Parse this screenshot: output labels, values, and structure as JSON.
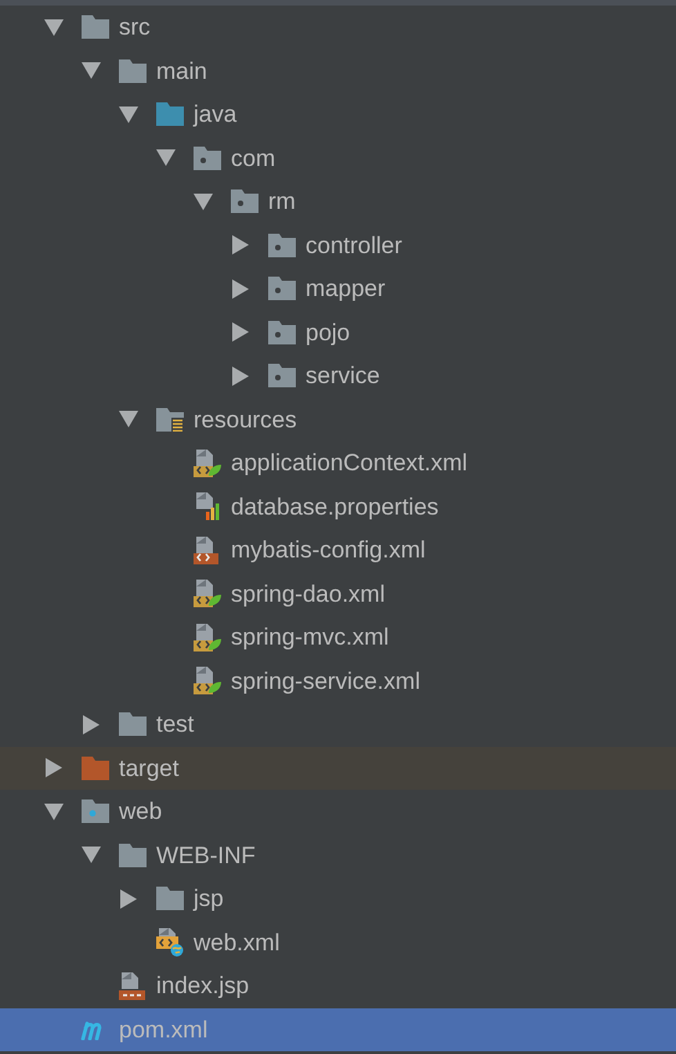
{
  "tree": [
    {
      "name": "src",
      "kind": "folder",
      "expanded": true,
      "selected": false,
      "children": [
        {
          "name": "main",
          "kind": "folder",
          "expanded": true,
          "selected": false,
          "children": [
            {
              "name": "java",
              "kind": "source-folder",
              "expanded": true,
              "selected": false,
              "children": [
                {
                  "name": "com",
                  "kind": "package",
                  "expanded": true,
                  "selected": false,
                  "children": [
                    {
                      "name": "rm",
                      "kind": "package",
                      "expanded": true,
                      "selected": false,
                      "children": [
                        {
                          "name": "controller",
                          "kind": "package",
                          "expanded": false,
                          "selected": false
                        },
                        {
                          "name": "mapper",
                          "kind": "package",
                          "expanded": false,
                          "selected": false
                        },
                        {
                          "name": "pojo",
                          "kind": "package",
                          "expanded": false,
                          "selected": false
                        },
                        {
                          "name": "service",
                          "kind": "package",
                          "expanded": false,
                          "selected": false
                        }
                      ]
                    }
                  ]
                }
              ]
            },
            {
              "name": "resources",
              "kind": "resources-folder",
              "expanded": true,
              "selected": false,
              "children": [
                {
                  "name": "applicationContext.xml",
                  "kind": "spring-xml",
                  "selected": false
                },
                {
                  "name": "database.properties",
                  "kind": "properties",
                  "selected": false
                },
                {
                  "name": "mybatis-config.xml",
                  "kind": "xml",
                  "selected": false
                },
                {
                  "name": "spring-dao.xml",
                  "kind": "spring-xml",
                  "selected": false
                },
                {
                  "name": "spring-mvc.xml",
                  "kind": "spring-xml",
                  "selected": false
                },
                {
                  "name": "spring-service.xml",
                  "kind": "spring-xml",
                  "selected": false
                }
              ]
            }
          ]
        },
        {
          "name": "test",
          "kind": "folder",
          "expanded": false,
          "selected": false
        }
      ]
    },
    {
      "name": "target",
      "kind": "excluded-folder",
      "expanded": false,
      "selected": false
    },
    {
      "name": "web",
      "kind": "web-folder",
      "expanded": true,
      "selected": false,
      "children": [
        {
          "name": "WEB-INF",
          "kind": "folder",
          "expanded": true,
          "selected": false,
          "children": [
            {
              "name": "jsp",
              "kind": "folder",
              "expanded": false,
              "selected": false
            },
            {
              "name": "web.xml",
              "kind": "web-xml",
              "selected": false
            }
          ]
        },
        {
          "name": "index.jsp",
          "kind": "jsp",
          "selected": false
        }
      ]
    },
    {
      "name": "pom.xml",
      "kind": "maven",
      "selected": true
    }
  ]
}
